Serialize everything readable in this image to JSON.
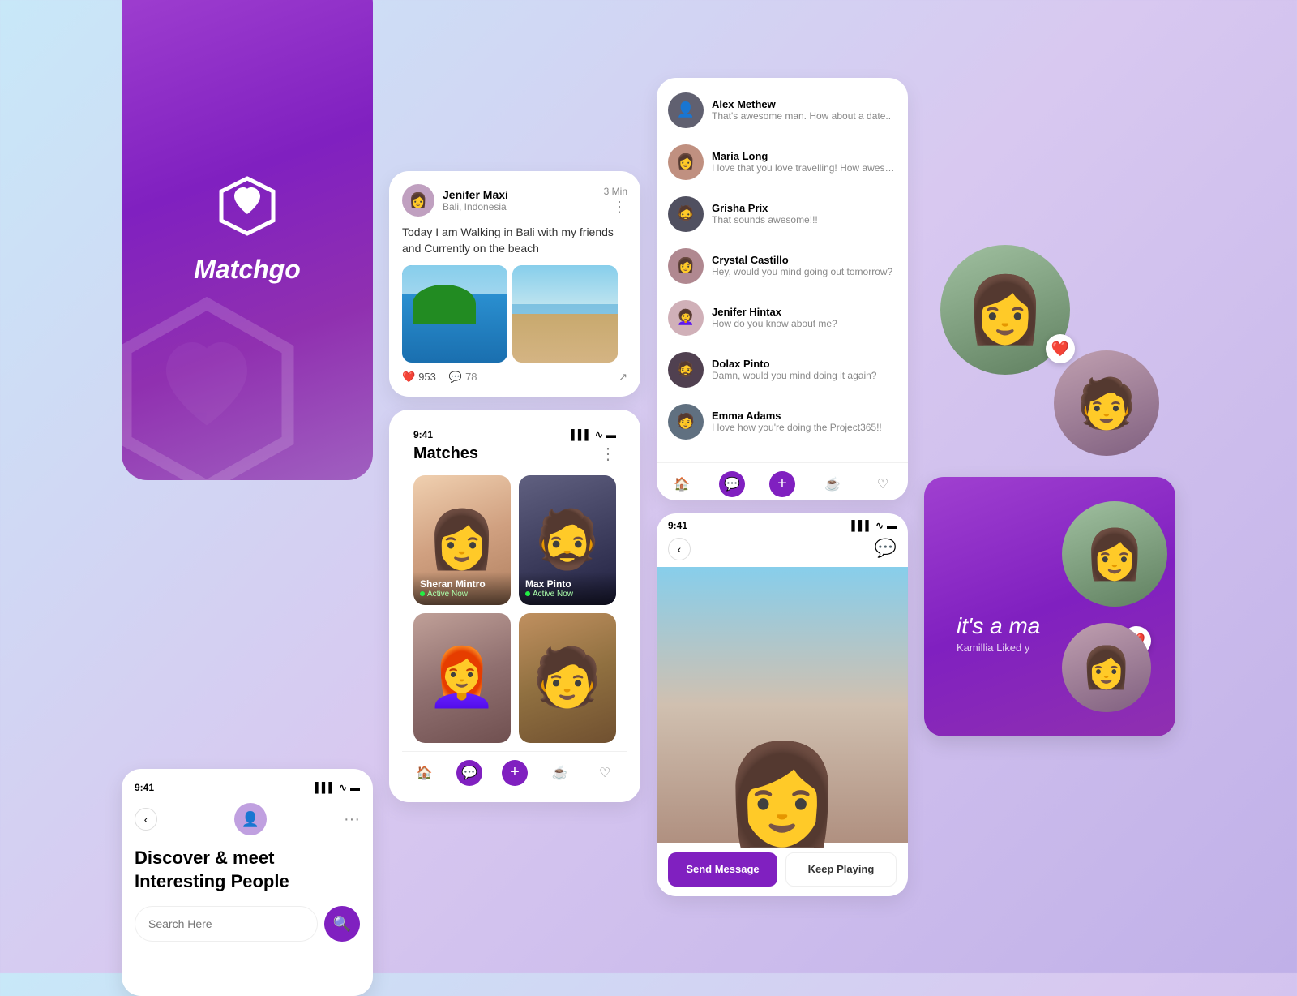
{
  "app": {
    "name": "Matchgo",
    "time": "9:41"
  },
  "splash": {
    "app_name": "Matchgo"
  },
  "discover": {
    "title_line1": "Discover & meet",
    "title_line2": "Interesting People",
    "search_placeholder": "Search Here"
  },
  "post": {
    "user_name": "Jenifer Maxi",
    "location": "Bali, Indonesia",
    "time": "3 Min",
    "text": "Today I am Walking in Bali with my friends and Currently on the beach",
    "likes": "953",
    "comments": "78"
  },
  "matches": {
    "title": "Matches",
    "people": [
      {
        "name": "Sheran Mintro",
        "status": "Active Now"
      },
      {
        "name": "Max Pinto",
        "status": "Active Now"
      },
      {
        "name": "",
        "status": ""
      },
      {
        "name": "",
        "status": ""
      }
    ]
  },
  "messages": {
    "contacts": [
      {
        "name": "Alex Methew",
        "last_msg": "That's awesome man. How about a date.."
      },
      {
        "name": "Maria Long",
        "last_msg": "I love that you love travelling! How awesome!"
      },
      {
        "name": "Grisha Prix",
        "last_msg": "That sounds awesome!!!"
      },
      {
        "name": "Crystal Castillo",
        "last_msg": "Hey, would you mind going out tomorrow?"
      },
      {
        "name": "Jenifer Hintax",
        "last_msg": "How do you know about me?"
      },
      {
        "name": "Dolax Pinto",
        "last_msg": "Damn, would you mind doing it again?"
      },
      {
        "name": "Emma Adams",
        "last_msg": "I love how you're doing the Project365!!"
      }
    ]
  },
  "profile": {
    "send_message": "Send Message",
    "keep_playing": "Keep Playing"
  },
  "match_celebration": {
    "text": "it's a ma",
    "liked_text": "Kamillia Liked y"
  },
  "tabs": {
    "home": "🏠",
    "chat": "💬",
    "plus": "+",
    "coffee": "☕",
    "heart": "♡"
  }
}
